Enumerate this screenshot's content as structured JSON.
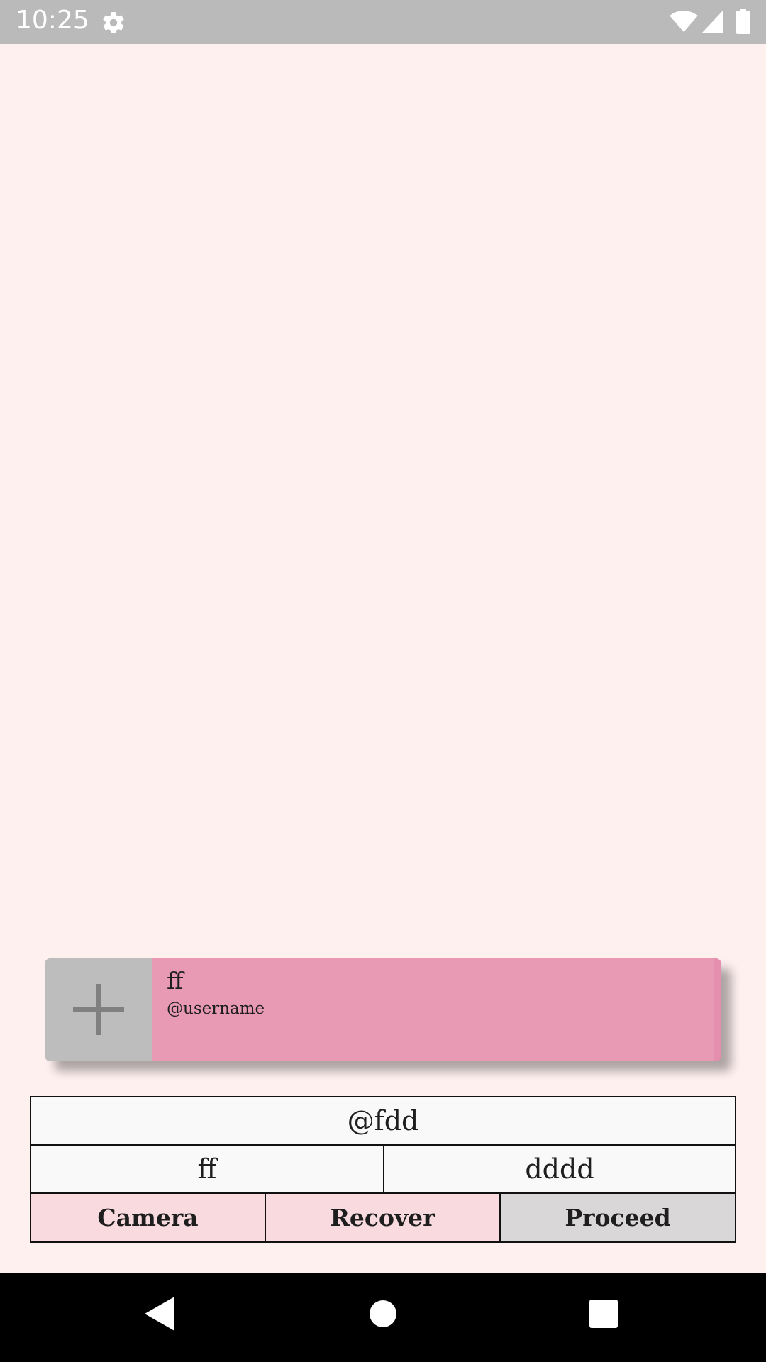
{
  "status_bar": {
    "time": "10:25",
    "icons": [
      "gear-icon",
      "wifi-icon",
      "signal-icon",
      "battery-icon"
    ]
  },
  "user_card": {
    "name": "ff",
    "username": "@username",
    "add_icon": "plus-icon",
    "colors": {
      "card": "#e899b4",
      "tile": "#bdbdbd"
    }
  },
  "info_table": {
    "handle": "@fdd",
    "left_value": "ff",
    "right_value": "dddd"
  },
  "actions": {
    "camera": "Camera",
    "recover": "Recover",
    "proceed": "Proceed"
  },
  "nav_bar": {
    "icons": [
      "back-icon",
      "home-icon",
      "recents-icon"
    ]
  },
  "colors": {
    "background": "#fff0f0",
    "status_bar": "#bababa",
    "nav_bar": "#000000",
    "button_pink": "#f9dbdf",
    "button_gray": "#d9d7d7"
  }
}
